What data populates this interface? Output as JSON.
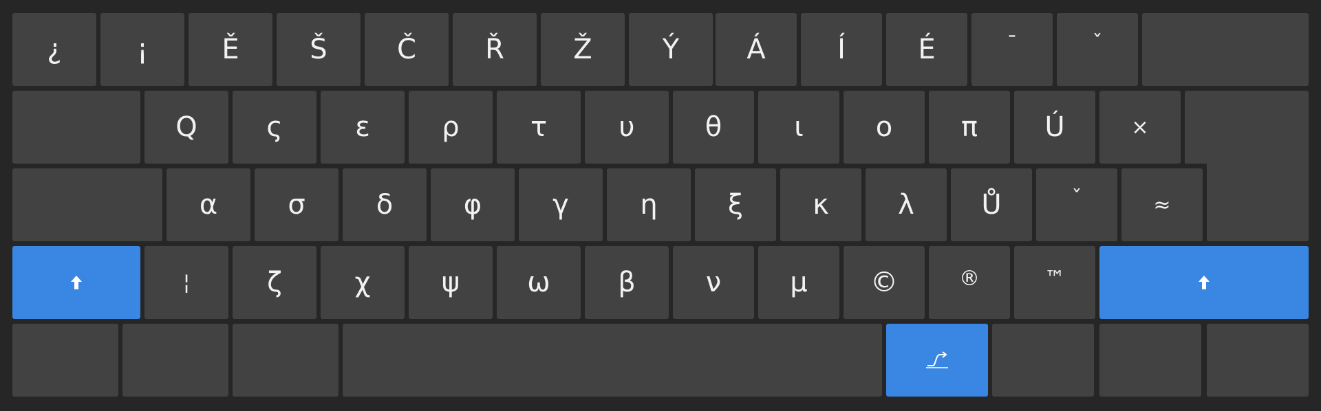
{
  "keyboard": {
    "accent_color": "#3a87e3",
    "key_color": "#424242",
    "background_color": "#262626",
    "row1": [
      "¿",
      "¡",
      "Ě",
      "Š",
      "Č",
      "Ř",
      "Ž",
      "Ý",
      "Á",
      "Í",
      "É",
      "ˉ",
      "ˇ",
      ""
    ],
    "row2": [
      "",
      "Q",
      "ς",
      "ε",
      "ρ",
      "τ",
      "υ",
      "θ",
      "ι",
      "ο",
      "π",
      "Ú",
      "×",
      ""
    ],
    "row3": [
      "",
      "α",
      "σ",
      "δ",
      "φ",
      "γ",
      "η",
      "ξ",
      "κ",
      "λ",
      "Ů",
      "ˇ",
      "≈",
      ""
    ],
    "row4": [
      "shift-icon",
      "¦",
      "ζ",
      "χ",
      "ψ",
      "ω",
      "β",
      "ν",
      "μ",
      "©",
      "®",
      "™",
      "shift-icon"
    ],
    "row5": [
      "",
      "",
      "",
      "",
      "layout-switch-icon",
      "",
      "",
      ""
    ]
  }
}
